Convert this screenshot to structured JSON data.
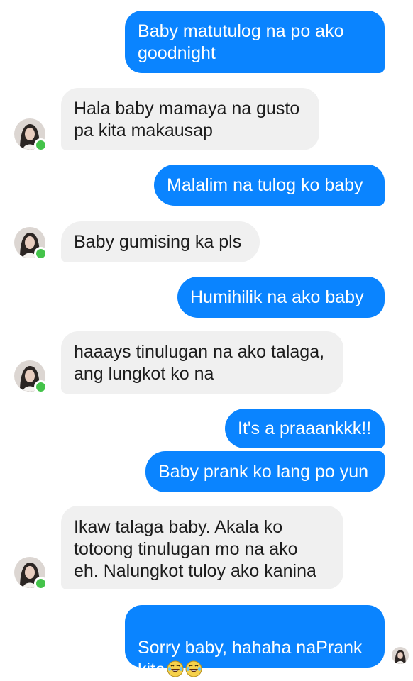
{
  "messages": [
    {
      "side": "out",
      "text": "Baby matutulog na po ako\ngoodnight"
    },
    {
      "side": "in",
      "text": "Hala baby mamaya na gusto\npa kita makausap"
    },
    {
      "side": "out",
      "text": "Malalim na tulog ko baby"
    },
    {
      "side": "in",
      "text": "Baby gumising ka pls"
    },
    {
      "side": "out",
      "text": "Humihilik na ako baby"
    },
    {
      "side": "in",
      "text": "haaays tinulugan na ako talaga,\nang lungkot ko na"
    },
    {
      "side": "out",
      "text": "It's a praaankkk!!"
    },
    {
      "side": "out",
      "text": "Baby prank ko lang po yun"
    },
    {
      "side": "in",
      "text": "Ikaw talaga baby. Akala ko\ntotoong tinulugan mo na ako\neh. Nalungkot tuloy ako kanina"
    },
    {
      "side": "out",
      "text": "Sorry baby, hahaha naPrank\nkita",
      "emojis": [
        "laughing-tears-emoji",
        "laughing-tears-emoji"
      ]
    }
  ],
  "colors": {
    "outgoing_bubble": "#0a84ff",
    "incoming_bubble": "#f0f0f0",
    "online_indicator": "#44c34a"
  },
  "icons": {
    "contact_avatar": "contact-avatar-icon",
    "online_status": "online-status-dot",
    "seen_receipt": "seen-avatar-icon"
  }
}
